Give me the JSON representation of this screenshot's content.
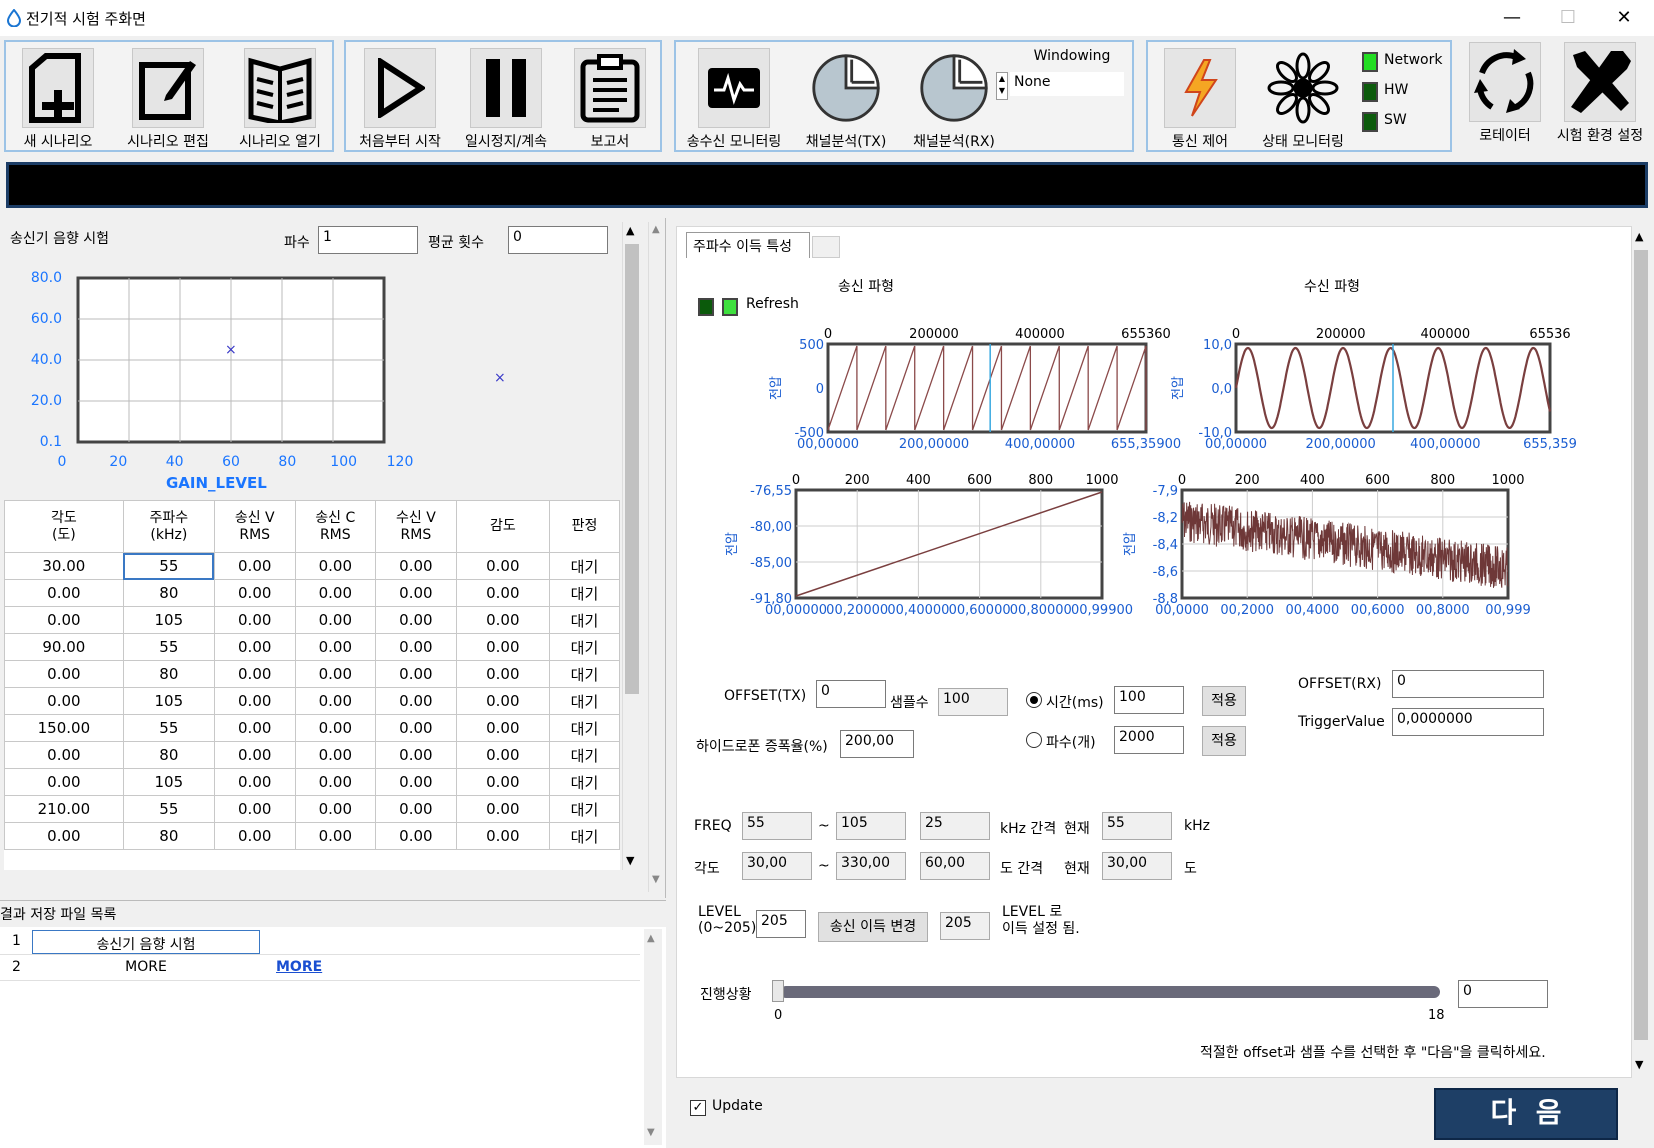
{
  "window": {
    "title": "전기적 시험 주화면",
    "minimize": "—",
    "maximize": "☐",
    "close": "✕"
  },
  "toolbar": {
    "new_scenario": "새 시나리오",
    "edit_scenario": "시나리오 편집",
    "open_scenario": "시나리오 열기",
    "start": "처음부터 시작",
    "pause": "일시정지/계속",
    "report": "보고서",
    "txrx_monitor": "송수신 모니터링",
    "channel_tx": "채널분석(TX)",
    "channel_rx": "채널분석(RX)",
    "windowing_label": "Windowing",
    "windowing_value": "None",
    "comm_control": "통신 제어",
    "status_monitor": "상태 모니터링",
    "net": "Network",
    "hw": "HW",
    "sw": "SW",
    "rotator": "로테이터",
    "env_setup": "시험 환경 설정"
  },
  "left": {
    "test_title": "송신기 음향 시험",
    "wave_label": "파수",
    "wave_value": "1",
    "avg_label": "평균 횟수",
    "avg_value": "0",
    "plot": {
      "xlabel": "GAIN_LEVEL",
      "yticks": [
        "80.0",
        "60.0",
        "40.0",
        "20.0",
        "0.1"
      ],
      "xticks": [
        "0",
        "20",
        "40",
        "60",
        "80",
        "100",
        "120"
      ],
      "marker": "×"
    },
    "table": {
      "headers": [
        [
          "각도",
          "(도)"
        ],
        [
          "주파수",
          "(kHz)"
        ],
        [
          "송신 V",
          "RMS"
        ],
        [
          "송신 C",
          "RMS"
        ],
        [
          "수신 V",
          "RMS"
        ],
        [
          "감도",
          ""
        ],
        [
          "판정",
          ""
        ]
      ],
      "rows": [
        [
          "30.00",
          "55",
          "0.00",
          "0.00",
          "0.00",
          "0.00",
          "대기"
        ],
        [
          "0.00",
          "80",
          "0.00",
          "0.00",
          "0.00",
          "0.00",
          "대기"
        ],
        [
          "0.00",
          "105",
          "0.00",
          "0.00",
          "0.00",
          "0.00",
          "대기"
        ],
        [
          "90.00",
          "55",
          "0.00",
          "0.00",
          "0.00",
          "0.00",
          "대기"
        ],
        [
          "0.00",
          "80",
          "0.00",
          "0.00",
          "0.00",
          "0.00",
          "대기"
        ],
        [
          "0.00",
          "105",
          "0.00",
          "0.00",
          "0.00",
          "0.00",
          "대기"
        ],
        [
          "150.00",
          "55",
          "0.00",
          "0.00",
          "0.00",
          "0.00",
          "대기"
        ],
        [
          "0.00",
          "80",
          "0.00",
          "0.00",
          "0.00",
          "0.00",
          "대기"
        ],
        [
          "0.00",
          "105",
          "0.00",
          "0.00",
          "0.00",
          "0.00",
          "대기"
        ],
        [
          "210.00",
          "55",
          "0.00",
          "0.00",
          "0.00",
          "0.00",
          "대기"
        ],
        [
          "0.00",
          "80",
          "0.00",
          "0.00",
          "0.00",
          "0.00",
          "대기"
        ]
      ]
    },
    "files": {
      "title": "결과 저장 파일 목록",
      "rows": [
        [
          "1",
          "송신기 음향 시험",
          ""
        ],
        [
          "2",
          "MORE",
          "MORE"
        ]
      ]
    }
  },
  "right": {
    "tab": "주파수 이득 특성",
    "refresh": "Refresh",
    "tx_title": "송신 파형",
    "rx_title": "수신 파형",
    "ylabel": "전압",
    "tx_top": {
      "top": [
        "0",
        "200000",
        "400000",
        "655360"
      ],
      "y": [
        "500",
        "0",
        "-500"
      ],
      "bottom": [
        "00,00000",
        "200,00000",
        "400,00000",
        "655,35900"
      ]
    },
    "rx_top": {
      "top": [
        "0",
        "200000",
        "400000",
        "65536"
      ],
      "y": [
        "10,0",
        "0,0",
        "-10,0"
      ],
      "bottom": [
        "00,00000",
        "200,00000",
        "400,00000",
        "655,359"
      ]
    },
    "tx_bot": {
      "top": [
        "0",
        "200",
        "400",
        "600",
        "800",
        "1000"
      ],
      "y": [
        "-76,55",
        "-80,00",
        "-85,00",
        "-91,80"
      ],
      "bottom": [
        "00,00000",
        "00,20000",
        "00,40000",
        "00,60000",
        "00,80000",
        "00,99900"
      ]
    },
    "rx_bot": {
      "top": [
        "0",
        "200",
        "400",
        "600",
        "800",
        "1000"
      ],
      "y": [
        "-7,9",
        "-8,2",
        "-8,4",
        "-8,6",
        "-8,8"
      ],
      "bottom": [
        "00,0000",
        "00,2000",
        "00,4000",
        "00,6000",
        "00,8000",
        "00,999"
      ]
    },
    "offset_tx_label": "OFFSET(TX)",
    "offset_tx": "0",
    "samples_label": "샘플수",
    "samples": "100",
    "time_label": "시간(ms)",
    "time_value": "100",
    "count_label": "파수(개)",
    "count_value": "2000",
    "apply": "적용",
    "hydro_label": "하이드로폰 증폭율(%)",
    "hydro_value": "200,00",
    "offset_rx_label": "OFFSET(RX)",
    "offset_rx": "0",
    "trigger_label": "TriggerValue",
    "trigger_value": "0,0000000",
    "freq_label": "FREQ",
    "freq_from": "55",
    "tilde": "~",
    "freq_to": "105",
    "freq_step": "25",
    "freq_step_unit": "kHz 간격",
    "cur_label": "현재",
    "freq_cur": "55",
    "freq_unit": "kHz",
    "ang_label": "각도",
    "ang_from": "30,00",
    "ang_to": "330,00",
    "ang_step": "60,00",
    "ang_step_unit": "도 간격",
    "ang_cur": "30,00",
    "ang_unit": "도",
    "level_label1": "LEVEL",
    "level_label2": "(0~205)",
    "level_value": "205",
    "gain_change": "송신 이득 변경",
    "level_set": "205",
    "level_note1": "LEVEL 로",
    "level_note2": "이득 설정 됨.",
    "progress_label": "진행상황",
    "progress_min": "0",
    "progress_max": "18",
    "progress_value": "0",
    "hint": "적절한 offset과 샘플 수를 선택한 후 \"다음\"을 클릭하세요."
  },
  "bottom": {
    "update": "Update",
    "next": "다  음"
  }
}
